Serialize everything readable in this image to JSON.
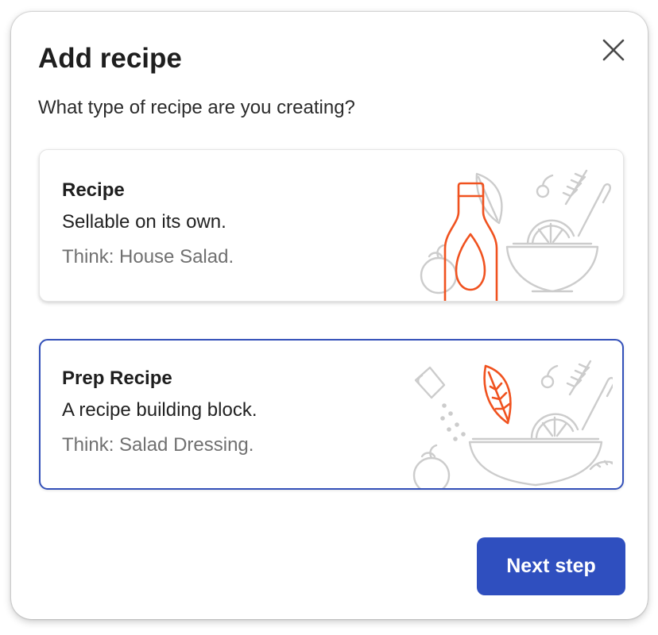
{
  "dialog": {
    "title": "Add recipe",
    "subtitle": "What type of recipe are you creating?",
    "close_icon": "close-icon"
  },
  "options": [
    {
      "title": "Recipe",
      "description": "Sellable on its own.",
      "hint": "Think: House Salad.",
      "selected": false,
      "illustration": "bottle-and-salad-bowl-illustration"
    },
    {
      "title": "Prep Recipe",
      "description": "A recipe building block.",
      "hint": "Think: Salad Dressing.",
      "selected": true,
      "illustration": "leaf-and-salad-bowl-illustration"
    }
  ],
  "footer": {
    "next_label": "Next step"
  },
  "colors": {
    "accent": "#2f4fbf",
    "selected_border": "#3350b9",
    "illustration_highlight": "#f0521f",
    "illustration_muted": "#c8c8c8"
  }
}
